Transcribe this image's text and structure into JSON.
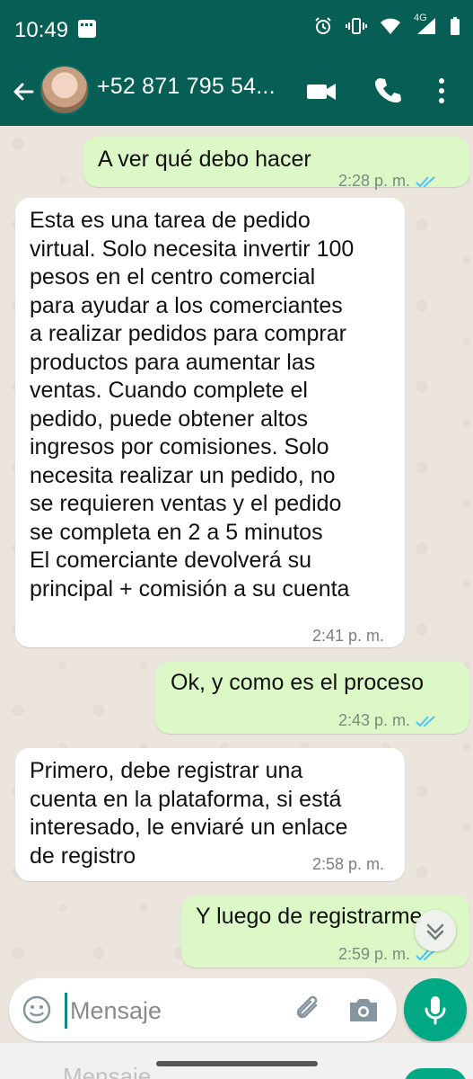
{
  "status_bar": {
    "time": "10:49",
    "network": "4G"
  },
  "header": {
    "contact_name": "+52 871 795 54..."
  },
  "messages": [
    {
      "direction": "out",
      "text": "A ver qué debo hacer",
      "time": "2:28 p. m."
    },
    {
      "direction": "in",
      "text": "Esta es una tarea de pedido\nvirtual. Solo necesita invertir 100\npesos en el centro comercial\npara ayudar a los comerciantes\na realizar pedidos para comprar\nproductos para aumentar las\nventas. Cuando complete el\npedido, puede obtener altos\ningresos por comisiones. Solo\nnecesita realizar un pedido, no\nse requieren ventas y el pedido\nse completa en 2 a 5 minutos\nEl comerciante devolverá su\nprincipal + comisión a su cuenta",
      "time": "2:41 p. m."
    },
    {
      "direction": "out",
      "text": "Ok, y como es el proceso",
      "time": "2:43 p. m."
    },
    {
      "direction": "in",
      "text": "Primero, debe registrar una\ncuenta en la plataforma, si está\ninteresado, le enviaré un enlace\nde registro",
      "time": "2:58 p. m."
    },
    {
      "direction": "out",
      "text": "Y luego de registrarme",
      "time": "2:59 p. m."
    }
  ],
  "composer": {
    "placeholder": "Mensaje"
  },
  "ghost_text": "Mensaje",
  "colors": {
    "header": "#075e54",
    "outgoing_bubble": "#dcf8c6",
    "incoming_bubble": "#ffffff",
    "accent": "#00a884",
    "read_ticks": "#4fc3f7"
  },
  "icons": [
    "back-arrow-icon",
    "video-call-icon",
    "phone-icon",
    "more-vert-icon",
    "emoji-icon",
    "attach-icon",
    "camera-icon",
    "mic-icon",
    "chevron-down-icon"
  ]
}
